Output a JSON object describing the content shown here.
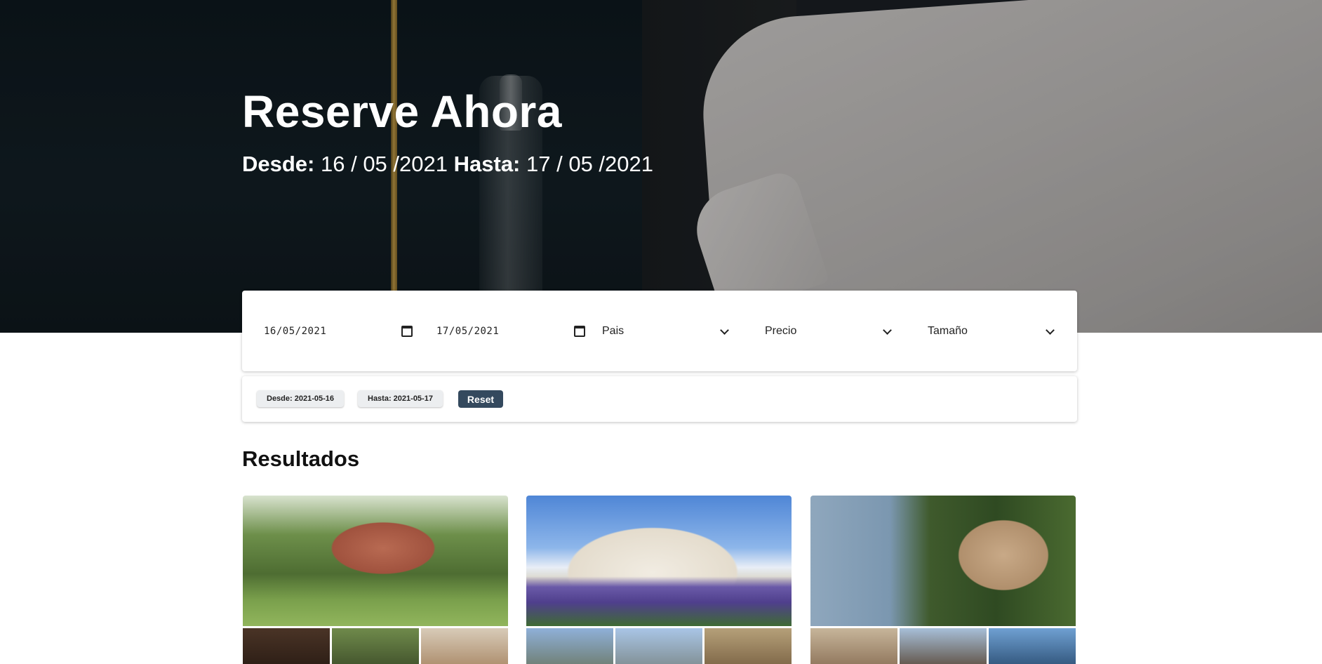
{
  "hero": {
    "title": "Reserve Ahora",
    "desde_label": "Desde:",
    "desde_value": "16 / 05 /2021",
    "hasta_label": "Hasta:",
    "hasta_value": "17 / 05 /2021"
  },
  "filters": {
    "desde_date": "16/05/2021",
    "hasta_date": "17/05/2021",
    "pais": "Pais",
    "precio": "Precio",
    "tamano": "Tamaño"
  },
  "chips": {
    "desde": "Desde: 2021-05-16",
    "hasta": "Hasta: 2021-05-17",
    "reset": "Reset"
  },
  "results": {
    "title": "Resultados"
  },
  "colors": {
    "reset_button": "#34495e",
    "chip_bg": "#eceef0"
  }
}
